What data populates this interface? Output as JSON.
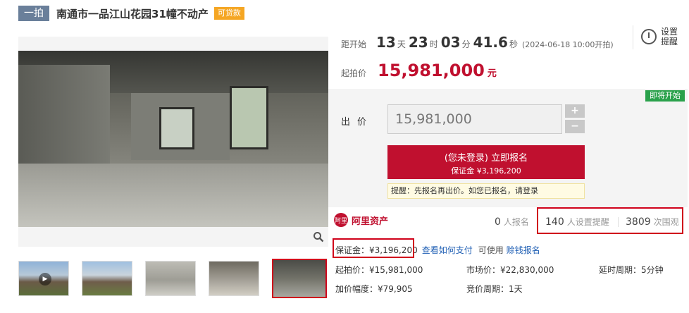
{
  "title": {
    "round_tag": "一拍",
    "text": "南通市一品江山花园31幢不动产",
    "loan_badge": "可贷款"
  },
  "countdown": {
    "label": "距开始",
    "days": "13",
    "days_unit": "天",
    "hours": "23",
    "hours_unit": "时",
    "minutes": "03",
    "minutes_unit": "分",
    "seconds": "41.6",
    "seconds_unit": "秒",
    "start_note": "(2024-06-18 10:00开拍)"
  },
  "reminder": {
    "label": "设置提醒",
    "icon": "alarm-clock-icon"
  },
  "start_price": {
    "label": "起拍价",
    "value": "15,981,000",
    "unit": "元"
  },
  "status_badge": "即将开始",
  "bid": {
    "label": "出价",
    "value": "15,981,000",
    "plus": "+",
    "minus": "−"
  },
  "signup": {
    "main": "(您未登录) 立即报名",
    "sub": "保证金 ¥3,196,200"
  },
  "notice": "提醒：先报名再出价。如您已报名，请登录",
  "platform": {
    "name": "阿里资产",
    "logo_text": "阿里"
  },
  "stats": {
    "signups_num": "0",
    "signups_label": "人报名",
    "reminders_num": "140",
    "reminders_label": "人设置提醒",
    "views_num": "3809",
    "views_label": "次围观"
  },
  "deposit": {
    "text": "保证金：¥3,196,200",
    "how_to_pay": "查看如何支付",
    "usable": "可使用",
    "credit_signup": "赊钱报名"
  },
  "details": {
    "start_price": "起拍价：¥15,981,000",
    "market_price": "市场价：¥22,830,000",
    "delay_period": "延时周期：5分钟",
    "increment": "加价幅度：¥79,905",
    "bid_period": "竞价周期：1天"
  },
  "colors": {
    "accent_red": "#c0102f",
    "highlight_box": "#d0021b",
    "status_green": "#2aa14b",
    "loan_orange": "#f5a623",
    "link_blue": "#1f5fb4"
  }
}
